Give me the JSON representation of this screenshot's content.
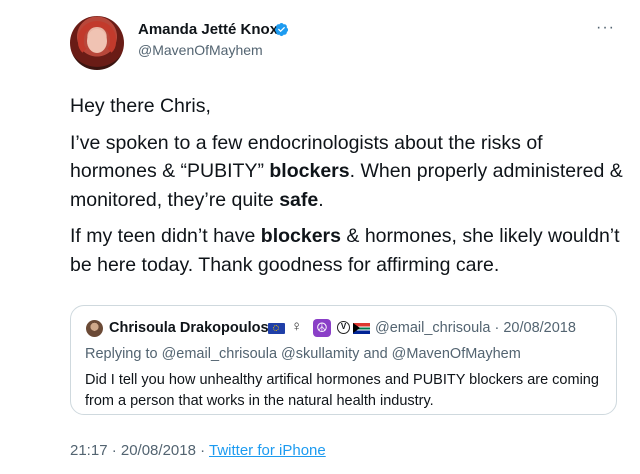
{
  "author": {
    "name": "Amanda Jetté Knox",
    "handle": "@MavenOfMayhem",
    "verified": true
  },
  "tweet": {
    "greeting": "Hey there Chris,",
    "p2_a": "I’ve spoken to a few endocrinologists about the risks of hormones & “PUBITY” ",
    "p2_bold1": "blockers",
    "p2_b": ". When properly administered & monitored, they’re quite ",
    "p2_bold2": "safe",
    "p2_c": ".",
    "p3_a": "If my teen didn’t have ",
    "p3_bold": "blockers",
    "p3_b": " & hormones, she likely wouldn’t be here today. Thank goodness for affirming care."
  },
  "quote": {
    "name": "Chrisoula Drakopoulos",
    "emoji": [
      "eu-flag-icon",
      "female-sign-icon",
      "peace-icon",
      "vegan-icon",
      "south-africa-flag-icon"
    ],
    "female_sign": "♀",
    "peace_symbol": "☮",
    "vegan_symbol": "V",
    "meta": "@email_chrisoula · 20/08/2018",
    "reply_line": "Replying to @email_chrisoula @skullamity and @MavenOfMayhem",
    "text": "Did I tell you how unhealthy artifical hormones and PUBITY blockers are coming from a person that works in the natural  health industry."
  },
  "footer": {
    "time_date": "21:17 · 20/08/2018 · ",
    "source": "Twitter for iPhone"
  },
  "colors": {
    "text": "#0f1419",
    "secondary": "#536471",
    "link": "#1d9bf0",
    "verified": "#1d9bf0",
    "border": "#cfd9de"
  }
}
